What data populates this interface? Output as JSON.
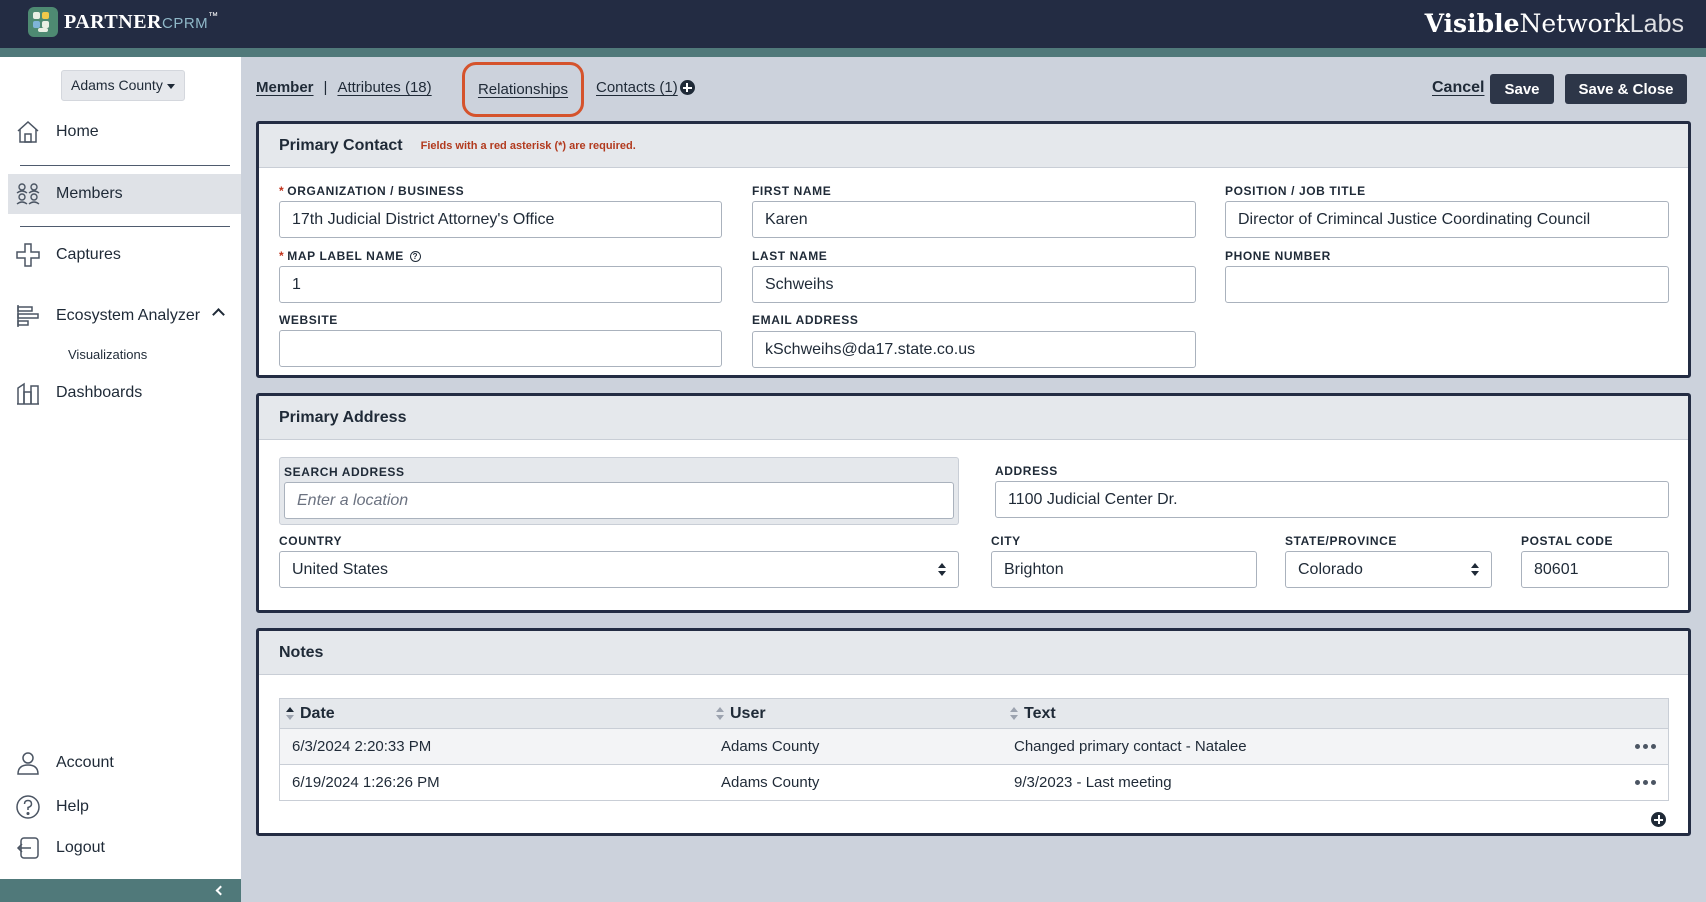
{
  "header": {
    "logo_main": "PARTNER",
    "logo_sub": "CPRM",
    "logo_tm": "™",
    "brand_bold": "Visible",
    "brand_mid": "Network",
    "brand_light": "Labs"
  },
  "sidebar": {
    "county": "Adams County",
    "items": [
      {
        "label": "Home",
        "icon": "home-icon"
      },
      {
        "label": "Members",
        "icon": "members-icon"
      },
      {
        "label": "Captures",
        "icon": "captures-icon"
      },
      {
        "label": "Ecosystem Analyzer",
        "icon": "ecosystem-icon"
      },
      {
        "label": "Dashboards",
        "icon": "dashboards-icon"
      }
    ],
    "sub_items": [
      {
        "label": "Visualizations"
      }
    ],
    "bottom_items": [
      {
        "label": "Account",
        "icon": "account-icon"
      },
      {
        "label": "Help",
        "icon": "help-icon"
      },
      {
        "label": "Logout",
        "icon": "logout-icon"
      }
    ]
  },
  "tabs": {
    "member": "Member",
    "separator": "|",
    "attributes": "Attributes (18)",
    "relationships": "Relationships",
    "contacts": "Contacts (1)"
  },
  "actions": {
    "cancel": "Cancel",
    "save": "Save",
    "save_close": "Save & Close"
  },
  "primary_contact": {
    "title": "Primary Contact",
    "required_note": "Fields with a red asterisk (*) are required.",
    "org_label": "ORGANIZATION / BUSINESS",
    "org_value": "17th Judicial District Attorney's Office",
    "map_label": "MAP LABEL NAME",
    "map_value": "1",
    "website_label": "WEBSITE",
    "website_value": "",
    "first_label": "FIRST NAME",
    "first_value": "Karen",
    "last_label": "LAST NAME",
    "last_value": "Schweihs",
    "email_label": "EMAIL ADDRESS",
    "email_value": "kSchweihs@da17.state.co.us",
    "position_label": "POSITION / JOB TITLE",
    "position_value": "Director of Crimincal Justice Coordinating Council",
    "phone_label": "PHONE NUMBER",
    "phone_value": ""
  },
  "primary_address": {
    "title": "Primary Address",
    "search_label": "SEARCH ADDRESS",
    "search_placeholder": "Enter a location",
    "address_label": "ADDRESS",
    "address_value": "1100 Judicial Center Dr.",
    "country_label": "COUNTRY",
    "country_value": "United States",
    "city_label": "CITY",
    "city_value": "Brighton",
    "state_label": "STATE/PROVINCE",
    "state_value": "Colorado",
    "postal_label": "POSTAL CODE",
    "postal_value": "80601"
  },
  "notes": {
    "title": "Notes",
    "columns": [
      "Date",
      "User",
      "Text"
    ],
    "rows": [
      {
        "date": "6/3/2024 2:20:33 PM",
        "user": "Adams County",
        "text": "Changed primary contact - Natalee"
      },
      {
        "date": "6/19/2024 1:26:26 PM",
        "user": "Adams County",
        "text": "9/3/2023 - Last meeting"
      }
    ]
  },
  "colors": {
    "topbar": "#232c43",
    "accent_stripe": "#50797a",
    "highlight_ring": "#d5532c",
    "required": "#b23a1e"
  }
}
